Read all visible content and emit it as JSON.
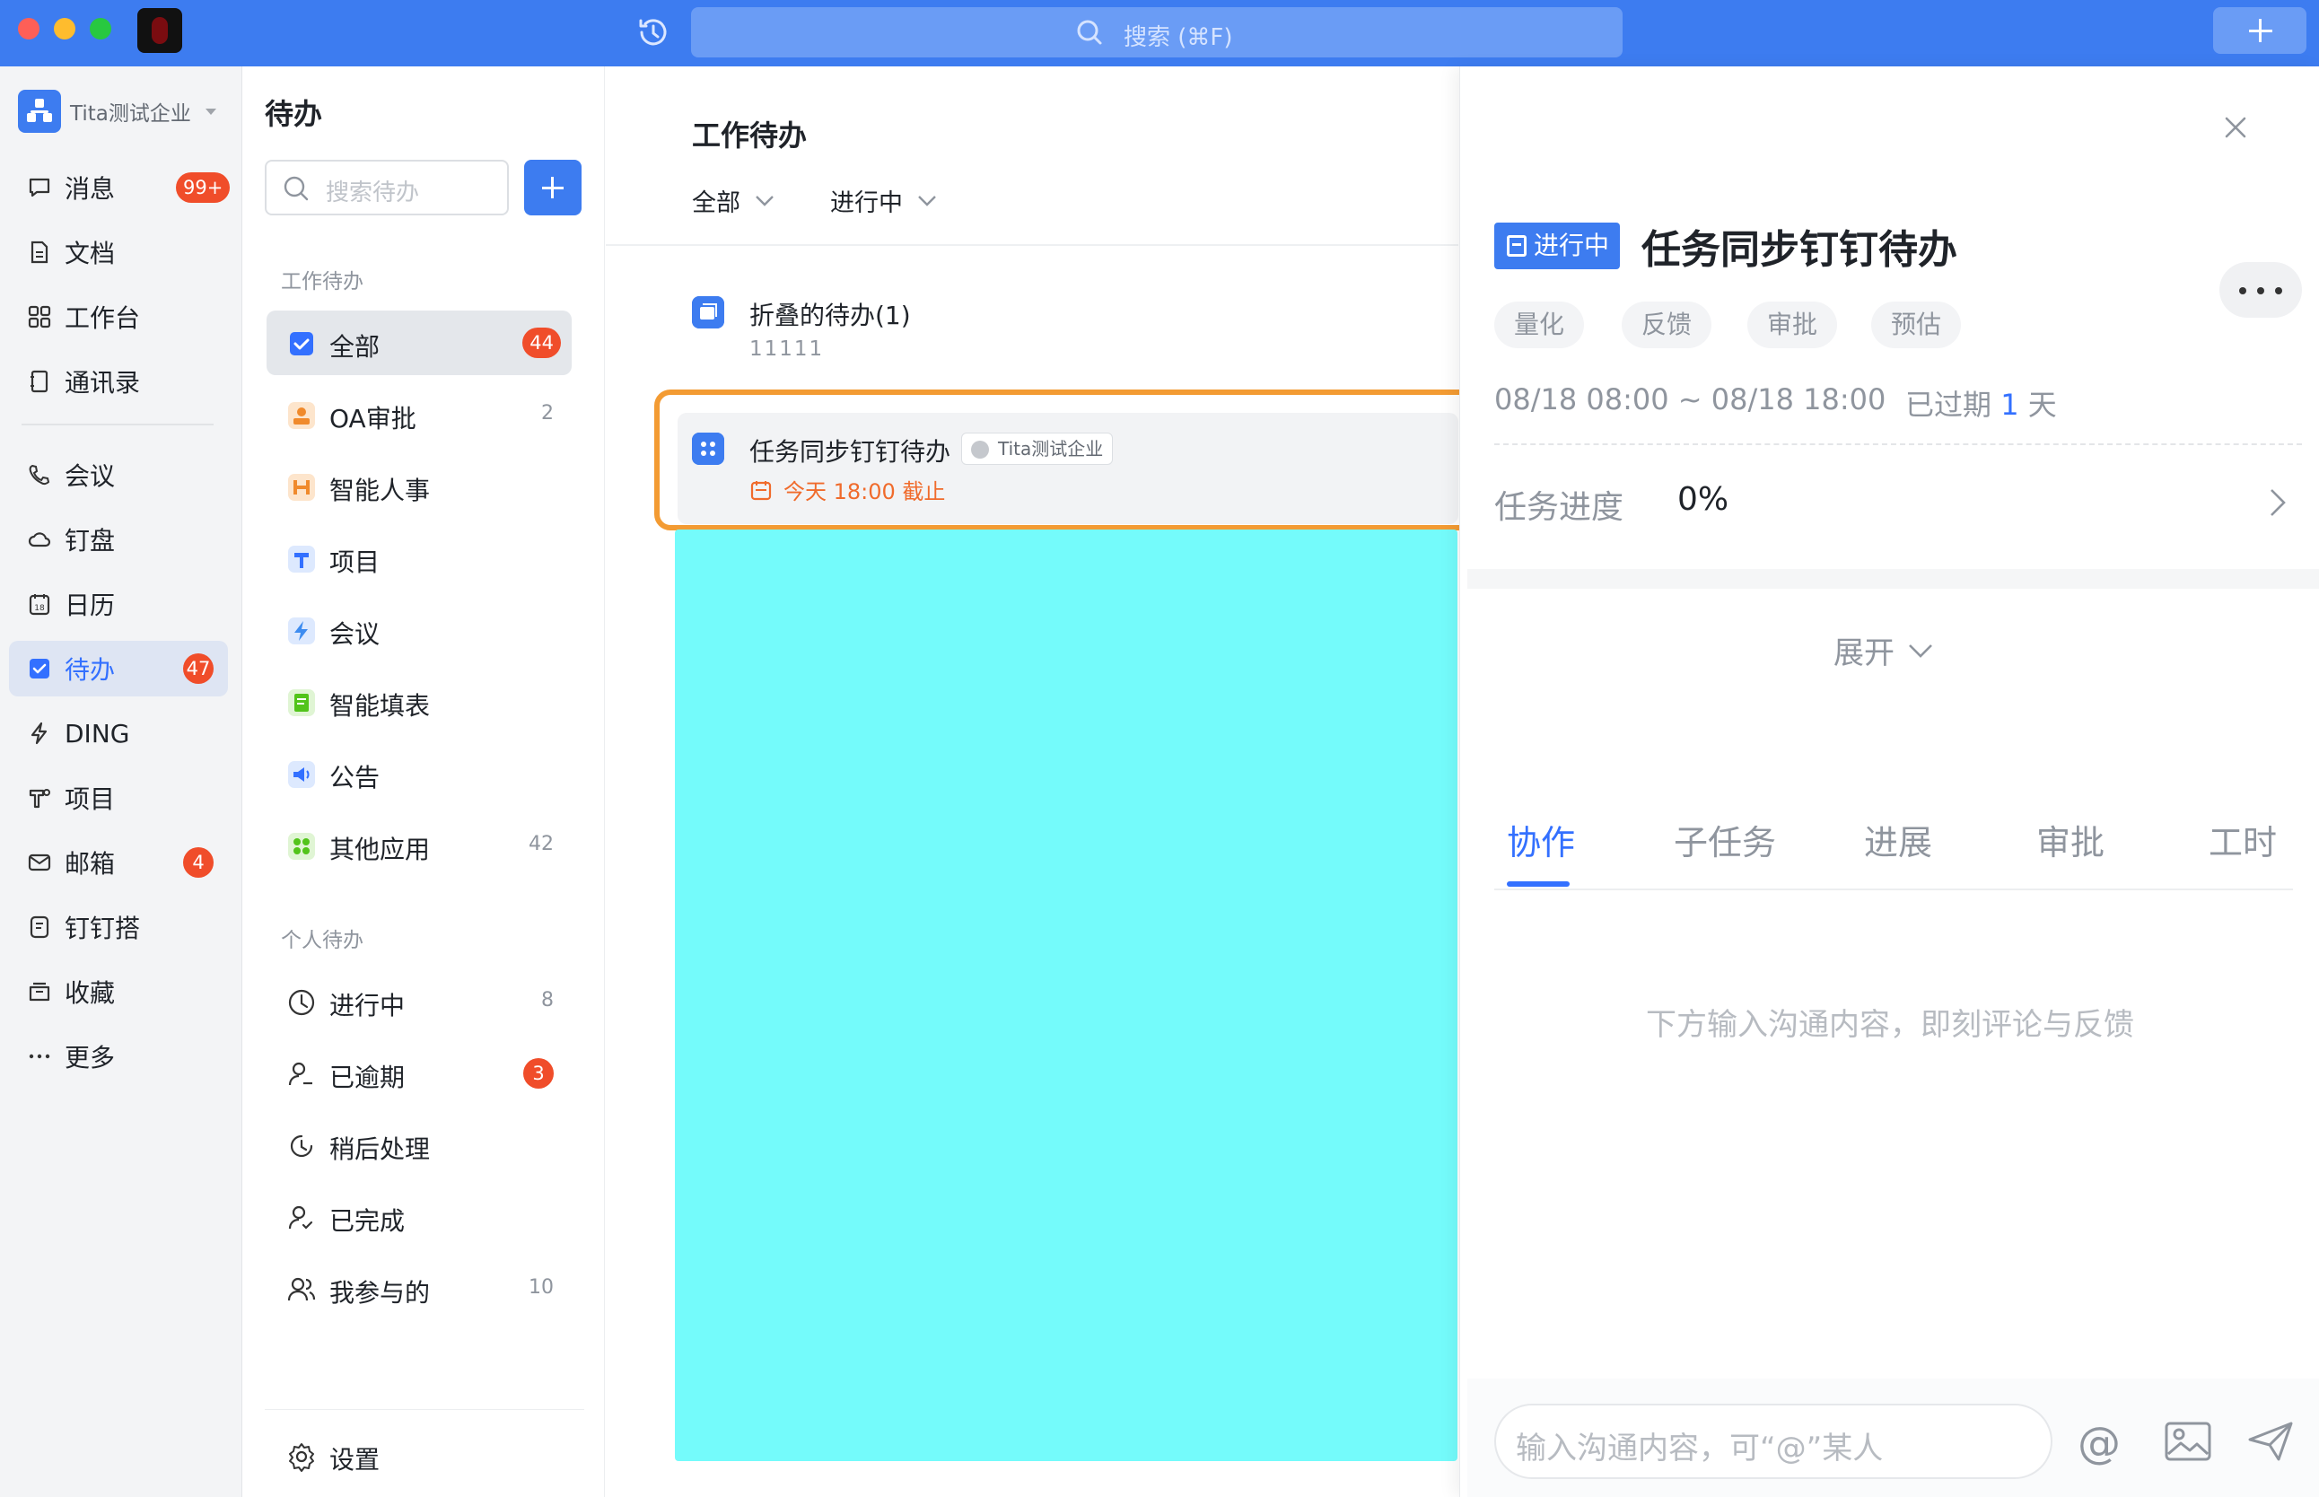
{
  "titlebar": {
    "search_placeholder": "搜索 (⌘F)",
    "icons": [
      "history-icon",
      "search-icon",
      "plus-icon"
    ]
  },
  "leftnav": {
    "org_name": "Tita测试企业",
    "items": [
      {
        "label": "消息",
        "badge": "99+",
        "icon": "message-icon"
      },
      {
        "label": "文档",
        "icon": "document-icon"
      },
      {
        "label": "工作台",
        "icon": "workbench-icon"
      },
      {
        "label": "通讯录",
        "icon": "contacts-icon"
      },
      {
        "label": "会议",
        "icon": "meeting-icon"
      },
      {
        "label": "钉盘",
        "icon": "cloud-icon"
      },
      {
        "label": "日历",
        "icon": "calendar-icon"
      },
      {
        "label": "待办",
        "badge": "47",
        "icon": "todo-icon",
        "active": true
      },
      {
        "label": "DING",
        "icon": "ding-icon"
      },
      {
        "label": "项目",
        "icon": "project-icon"
      },
      {
        "label": "邮箱",
        "badge": "4",
        "icon": "mail-icon"
      },
      {
        "label": "钉钉搭",
        "icon": "builder-icon"
      },
      {
        "label": "收藏",
        "icon": "favorites-icon"
      },
      {
        "label": "更多",
        "icon": "more-icon"
      }
    ]
  },
  "todopanel": {
    "title": "待办",
    "search_placeholder": "搜索待办",
    "work_section": "工作待办",
    "work_items": [
      {
        "label": "全部",
        "badge": "44",
        "active": true,
        "color": "#3d7cf0"
      },
      {
        "label": "OA审批",
        "count": "2",
        "color": "#f5a04a"
      },
      {
        "label": "智能人事",
        "count": "",
        "color": "#f39a3c"
      },
      {
        "label": "项目",
        "count": "",
        "color": "#3d7cf0"
      },
      {
        "label": "会议",
        "count": "",
        "color": "#3d8cf0"
      },
      {
        "label": "智能填表",
        "count": "",
        "color": "#52c41a"
      },
      {
        "label": "公告",
        "count": "",
        "color": "#3d7cf0"
      },
      {
        "label": "其他应用",
        "count": "42",
        "color": "#52c41a"
      }
    ],
    "personal_section": "个人待办",
    "personal_items": [
      {
        "label": "进行中",
        "count": "8",
        "icon": "clock-icon"
      },
      {
        "label": "已逾期",
        "badge": "3",
        "icon": "user-overdue-icon"
      },
      {
        "label": "稍后处理",
        "count": "",
        "icon": "later-icon"
      },
      {
        "label": "已完成",
        "count": "",
        "icon": "user-done-icon"
      },
      {
        "label": "我参与的",
        "count": "10",
        "icon": "group-icon"
      }
    ],
    "settings_label": "设置"
  },
  "midpanel": {
    "title": "工作待办",
    "filter_scope": "全部",
    "filter_status": "进行中",
    "folded": {
      "title": "折叠的待办(1)",
      "sub": "11111"
    },
    "task": {
      "title": "任务同步钉钉待办",
      "org_tag": "Tita测试企业",
      "due": "今天 18:00 截止"
    },
    "colors": {
      "highlight": "#f39b33",
      "placeholder_block": "#74fbfb"
    }
  },
  "detail": {
    "status": "进行中",
    "title": "任务同步钉钉待办",
    "chips": [
      "量化",
      "反馈",
      "审批",
      "预估"
    ],
    "date_range": "08/18 08:00 ~ 08/18 18:00",
    "overdue_prefix": "已过期",
    "overdue_days": "1",
    "overdue_suffix": "天",
    "progress_label": "任务进度",
    "progress_value": "0%",
    "expand_label": "展开",
    "tabs": [
      "协作",
      "子任务",
      "进展",
      "审批",
      "工时"
    ],
    "empty_hint": "下方输入沟通内容，即刻评论与反馈",
    "composer_placeholder": "输入沟通内容，可“@”某人",
    "at_symbol": "@"
  }
}
